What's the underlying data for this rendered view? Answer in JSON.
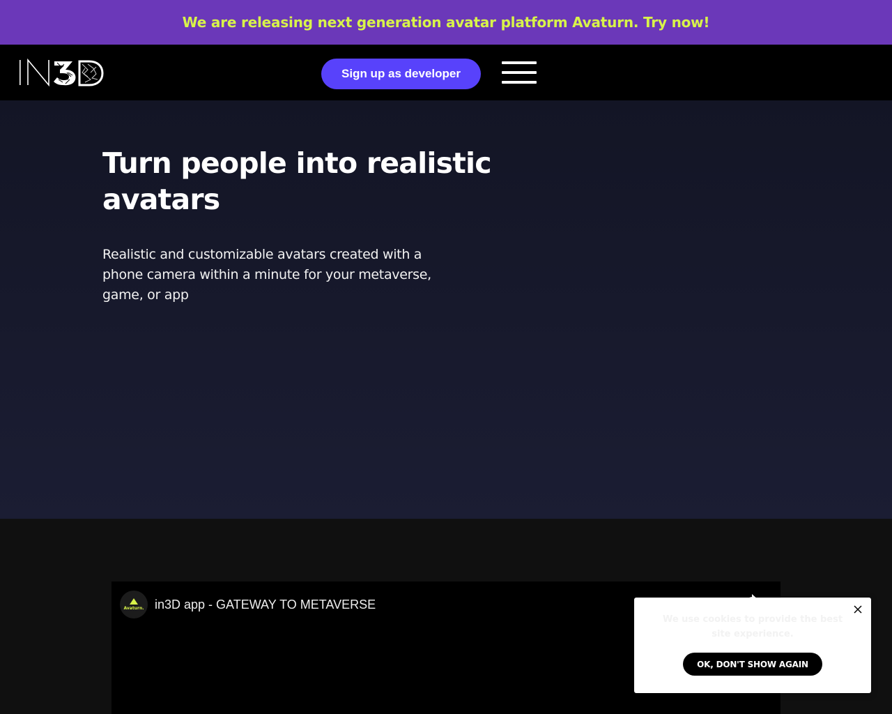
{
  "announcement": {
    "text": "We are releasing next generation avatar platform Avaturn. Try now!"
  },
  "header": {
    "logo_text": "IN3D",
    "signup_label": "Sign up as developer",
    "menu_icon": "hamburger-menu-icon"
  },
  "hero": {
    "title": "Turn people into realistic avatars",
    "subtitle": "Realistic and customizable avatars created with a phone camera within a minute for your metaverse, game, or app"
  },
  "video": {
    "channel_name": "Avaturn.",
    "title": "in3D app - GATEWAY TO METAVERSE",
    "share_icon": "share-icon"
  },
  "cookie": {
    "text": "We use cookies to provide the best site experience.",
    "ok_label": "OK, DON'T SHOW AGAIN",
    "close_icon": "close-icon"
  },
  "colors": {
    "banner_bg": "#6b38b9",
    "banner_text": "#d8f34a",
    "accent_button": "#5842fb",
    "hero_bg": "#161829"
  }
}
